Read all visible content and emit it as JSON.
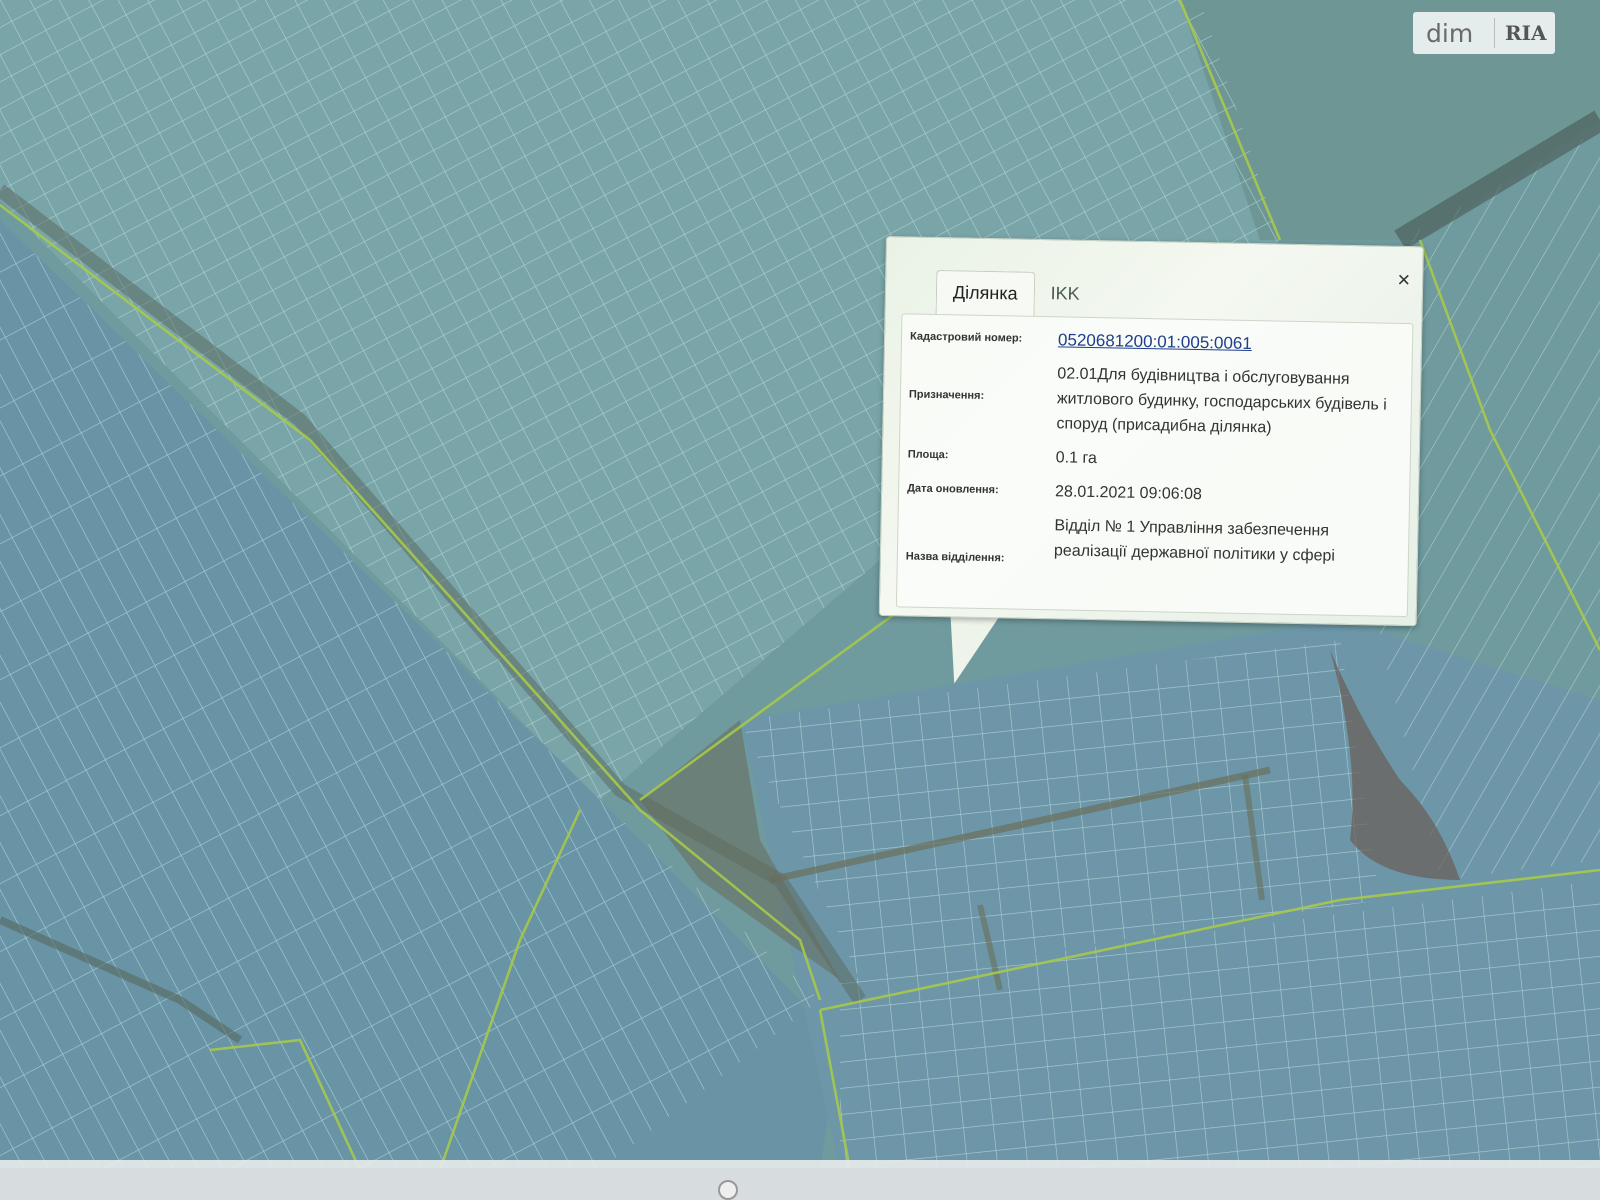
{
  "watermark": {
    "brand_left": "dim",
    "brand_right": "RIA"
  },
  "popup": {
    "tabs": [
      {
        "label": "Ділянка",
        "active": true
      },
      {
        "label": "IKK",
        "active": false
      }
    ],
    "fields": [
      {
        "label": "Кадастровий номер:",
        "value": "0520681200:01:005:0061"
      },
      {
        "label": "Призначення:",
        "value": "02.01Для будівництва і обслуговування житлового будинку, господарських будівель і споруд (присадибна ділянка)"
      },
      {
        "label": "Площа:",
        "value": "0.1 га"
      },
      {
        "label": "Дата оновлення:",
        "value": "28.01.2021 09:06:08"
      },
      {
        "label": "Назва відділення:",
        "value": "Відділ № 1 Управління забезпечення реалізації державної політики у сфері"
      }
    ],
    "close_glyph": "×"
  },
  "map": {
    "colors": {
      "base": "#6f9a9e",
      "parcel_line": "#b9d8dc",
      "boundary": "#a6c94a",
      "road": "#6b6f5a"
    }
  }
}
